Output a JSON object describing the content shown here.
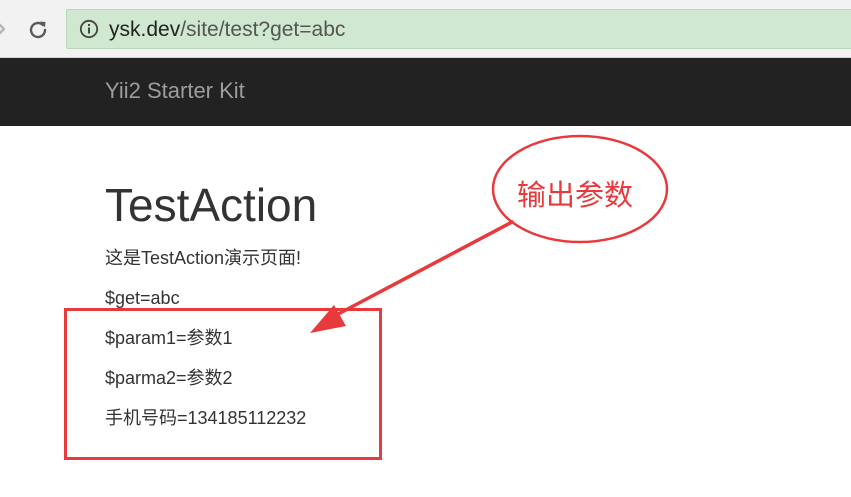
{
  "browser": {
    "url_host": "ysk.dev",
    "url_path": "/site/test?get=abc",
    "icons": {
      "forward": "forward-arrow-icon",
      "reload": "reload-icon",
      "info": "info-icon"
    },
    "omnibox_color": "#cfe8cf"
  },
  "navbar": {
    "brand": "Yii2 Starter Kit",
    "background": "#222222"
  },
  "main": {
    "title": "TestAction",
    "lines": [
      "这是TestAction演示页面!",
      "$get=abc",
      "$param1=参数1",
      "$parma2=参数2",
      "手机号码=134185112232"
    ]
  },
  "annotation": {
    "label": "输出参数",
    "color": "#e8393c"
  }
}
